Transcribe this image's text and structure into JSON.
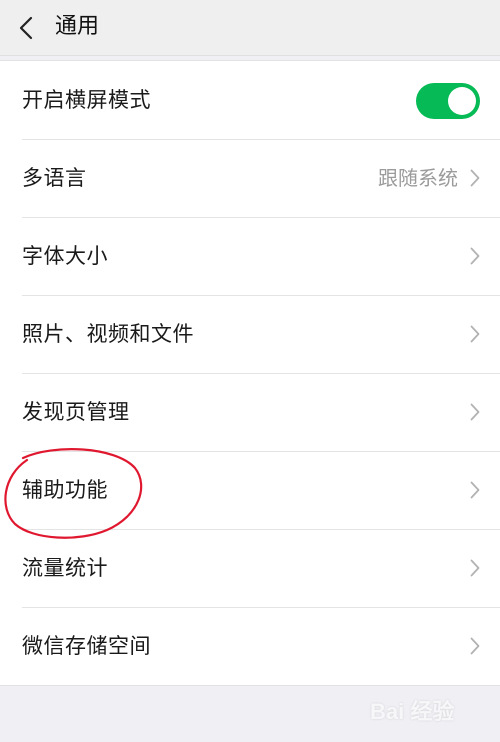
{
  "header": {
    "title": "通用",
    "back_icon": "chevron-left-icon"
  },
  "settings": {
    "landscape": {
      "label": "开启横屏模式",
      "enabled": true,
      "accent_color": "#06ba56"
    },
    "language": {
      "label": "多语言",
      "value": "跟随系统"
    },
    "font_size": {
      "label": "字体大小"
    },
    "media_files": {
      "label": "照片、视频和文件"
    },
    "discover": {
      "label": "发现页管理"
    },
    "accessibility": {
      "label": "辅助功能",
      "highlight_color": "#e0182f"
    },
    "data_usage": {
      "label": "流量统计"
    },
    "storage": {
      "label": "微信存储空间"
    }
  },
  "watermark": {
    "text": "Bai 经验"
  }
}
